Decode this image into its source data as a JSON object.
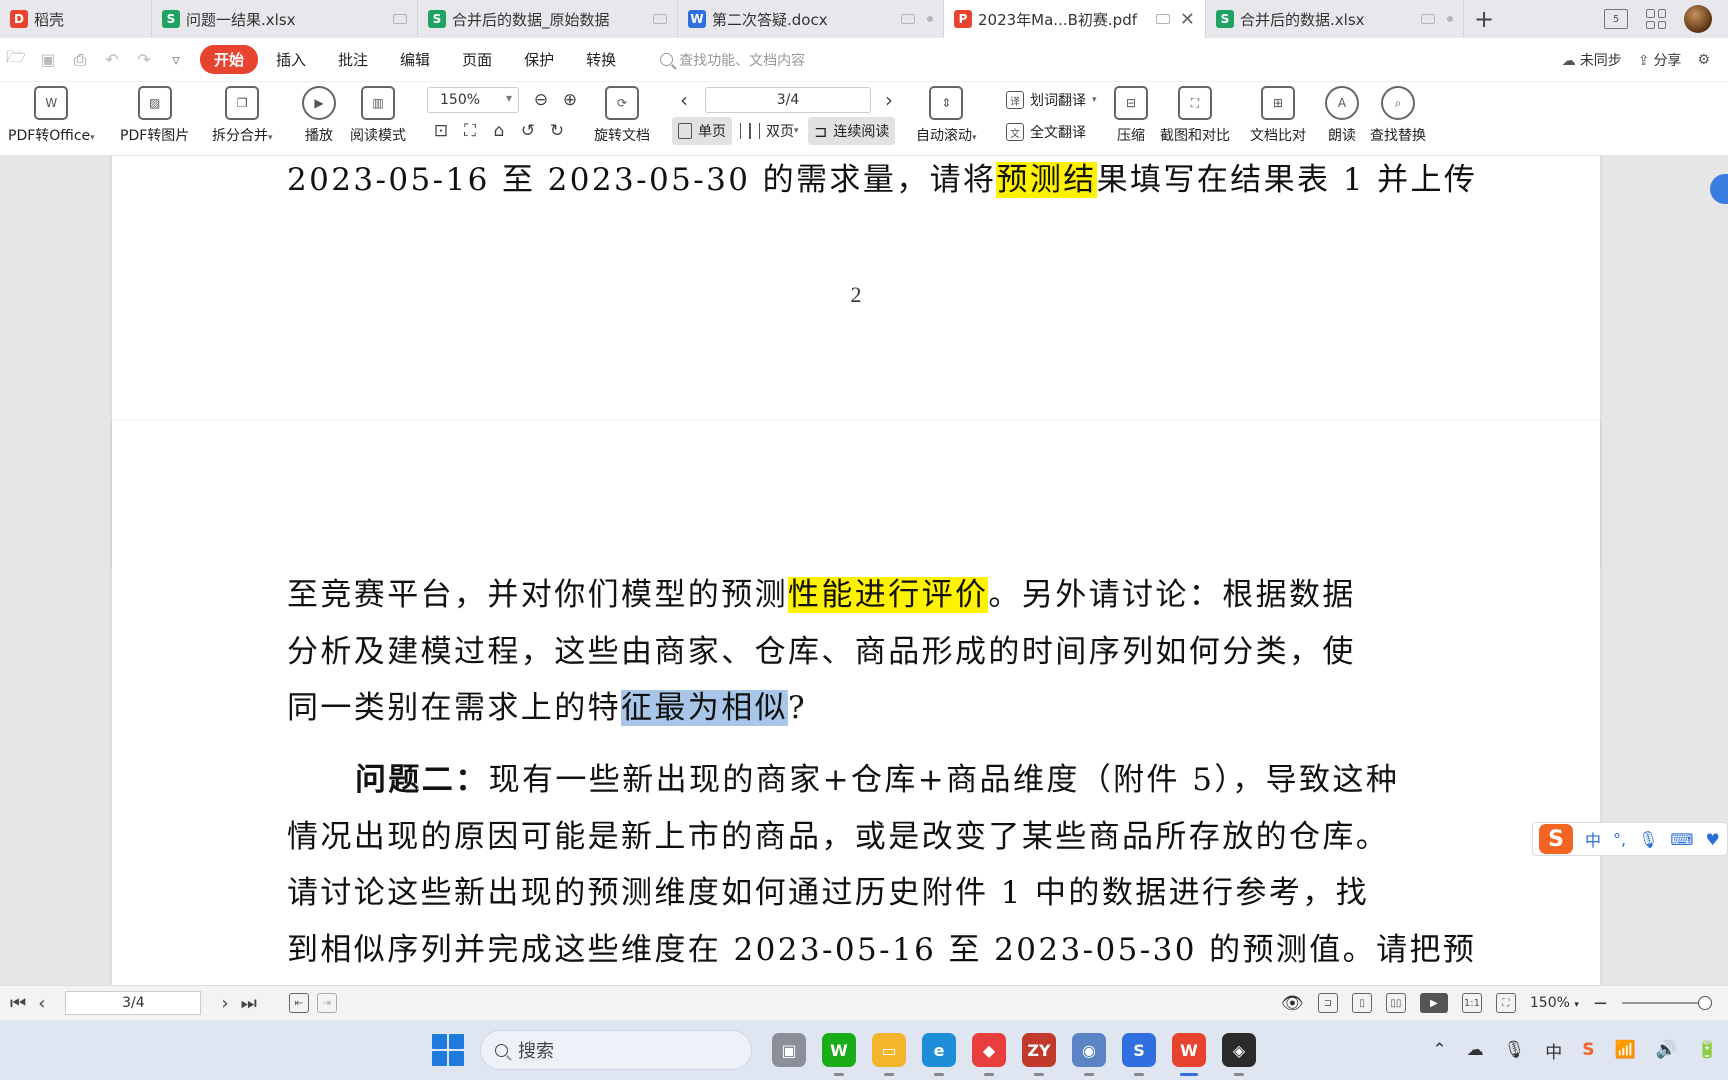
{
  "tabs": [
    {
      "label": "稻壳",
      "icon": "docer-icon",
      "icon_color": "#e8432f",
      "glyph": "D",
      "active": false
    },
    {
      "label": "问题一结果.xlsx",
      "icon": "spreadsheet-icon",
      "icon_color": "#1ea362",
      "glyph": "S",
      "active": false
    },
    {
      "label": "合并后的数据_原始数据",
      "icon": "spreadsheet-icon",
      "icon_color": "#1ea362",
      "glyph": "S",
      "active": false
    },
    {
      "label": "第二次答疑.docx",
      "icon": "writer-icon",
      "icon_color": "#2f6fe0",
      "glyph": "W",
      "active": false
    },
    {
      "label": "2023年Ma...B初赛.pdf",
      "icon": "pdf-icon",
      "icon_color": "#e8432f",
      "glyph": "P",
      "active": true
    },
    {
      "label": "合并后的数据.xlsx",
      "icon": "spreadsheet-icon",
      "icon_color": "#1ea362",
      "glyph": "S",
      "active": false
    }
  ],
  "tabbar": {
    "add_label": "+",
    "window_badge": "5"
  },
  "menu": {
    "items": [
      "开始",
      "插入",
      "批注",
      "编辑",
      "页面",
      "保护",
      "转换"
    ],
    "active_index": 0,
    "search_placeholder": "查找功能、文档内容",
    "sync_label": "未同步",
    "share_label": "分享"
  },
  "ribbon": {
    "pdf_to_office": "PDF转Office",
    "pdf_to_image": "PDF转图片",
    "split_merge": "拆分合并",
    "play": "播放",
    "read_mode": "阅读模式",
    "zoom": "150%",
    "rotate": "旋转文档",
    "page_indicator": "3/4",
    "single_page": "单页",
    "double_page": "双页",
    "continuous": "连续阅读",
    "auto_scroll": "自动滚动",
    "word_translate": "划词翻译",
    "full_translate": "全文翻译",
    "compress": "压缩",
    "screenshot_compare": "截图和对比",
    "doc_compare": "文档比对",
    "read_aloud": "朗读",
    "find_replace": "查找替换"
  },
  "document": {
    "page2_line1_a": "2023-05-16 至 2023-05-30 的需求量，请将",
    "page2_line1_hl": "预测结",
    "page2_line1_b": "果填写在结果表 1 并上传",
    "page2_number": "2",
    "p3_l1_a": "至竞赛平台，并对你们模型的预测",
    "p3_l1_hl": "性能进行评价",
    "p3_l1_b": "。另外请讨论：根据数据",
    "p3_l2": "分析及建模过程，这些由商家、仓库、商品形成的时间序列如何分类，使",
    "p3_l3_a": "同一类别在需求上的特",
    "p3_l3_sel": "征最为相似",
    "p3_l3_b": "?",
    "p3_q2_title": "问题二：",
    "p3_q2_l1": "现有一些新出现的商家+仓库+商品维度（附件 5），导致这种",
    "p3_q2_l2": "情况出现的原因可能是新上市的商品，或是改变了某些商品所存放的仓库。",
    "p3_q2_l3": "请讨论这些新出现的预测维度如何通过历史附件 1 中的数据进行参考，找",
    "p3_q2_l4": "到相似序列并完成这些维度在 2023-05-16 至 2023-05-30 的预测值。请把预"
  },
  "ime": {
    "logo": "S",
    "mode": "中",
    "punct": "°,"
  },
  "statusbar": {
    "page": "3/4",
    "zoom": "150%"
  },
  "taskbar": {
    "search_label": "搜索",
    "apps": [
      {
        "name": "task-view",
        "color": "#8a8f99",
        "glyph": "▣"
      },
      {
        "name": "wechat",
        "color": "#1aad19",
        "glyph": "W"
      },
      {
        "name": "file-explorer",
        "color": "#f2b52b",
        "glyph": "▭"
      },
      {
        "name": "edge",
        "color": "#1d8fd8",
        "glyph": "e"
      },
      {
        "name": "app-red",
        "color": "#e83e3e",
        "glyph": "◆"
      },
      {
        "name": "zy",
        "color": "#c0392b",
        "glyph": "ZY"
      },
      {
        "name": "app-globe",
        "color": "#5b84c4",
        "glyph": "◉"
      },
      {
        "name": "sogou",
        "color": "#2f6fe0",
        "glyph": "S"
      },
      {
        "name": "wps",
        "color": "#e8432f",
        "glyph": "W"
      },
      {
        "name": "game-app",
        "color": "#2b2b2b",
        "glyph": "◈"
      }
    ],
    "tray_ime": "中"
  }
}
